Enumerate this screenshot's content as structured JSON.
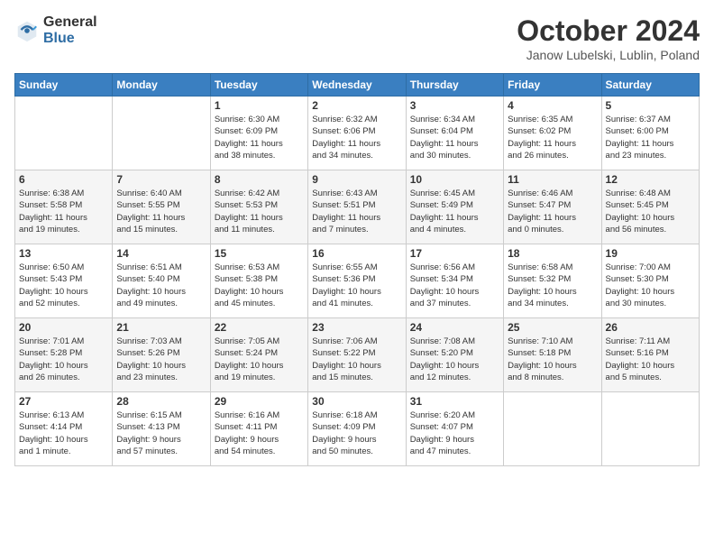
{
  "logo": {
    "general": "General",
    "blue": "Blue"
  },
  "title": "October 2024",
  "location": "Janow Lubelski, Lublin, Poland",
  "days_of_week": [
    "Sunday",
    "Monday",
    "Tuesday",
    "Wednesday",
    "Thursday",
    "Friday",
    "Saturday"
  ],
  "weeks": [
    [
      {
        "num": "",
        "info": ""
      },
      {
        "num": "",
        "info": ""
      },
      {
        "num": "1",
        "info": "Sunrise: 6:30 AM\nSunset: 6:09 PM\nDaylight: 11 hours\nand 38 minutes."
      },
      {
        "num": "2",
        "info": "Sunrise: 6:32 AM\nSunset: 6:06 PM\nDaylight: 11 hours\nand 34 minutes."
      },
      {
        "num": "3",
        "info": "Sunrise: 6:34 AM\nSunset: 6:04 PM\nDaylight: 11 hours\nand 30 minutes."
      },
      {
        "num": "4",
        "info": "Sunrise: 6:35 AM\nSunset: 6:02 PM\nDaylight: 11 hours\nand 26 minutes."
      },
      {
        "num": "5",
        "info": "Sunrise: 6:37 AM\nSunset: 6:00 PM\nDaylight: 11 hours\nand 23 minutes."
      }
    ],
    [
      {
        "num": "6",
        "info": "Sunrise: 6:38 AM\nSunset: 5:58 PM\nDaylight: 11 hours\nand 19 minutes."
      },
      {
        "num": "7",
        "info": "Sunrise: 6:40 AM\nSunset: 5:55 PM\nDaylight: 11 hours\nand 15 minutes."
      },
      {
        "num": "8",
        "info": "Sunrise: 6:42 AM\nSunset: 5:53 PM\nDaylight: 11 hours\nand 11 minutes."
      },
      {
        "num": "9",
        "info": "Sunrise: 6:43 AM\nSunset: 5:51 PM\nDaylight: 11 hours\nand 7 minutes."
      },
      {
        "num": "10",
        "info": "Sunrise: 6:45 AM\nSunset: 5:49 PM\nDaylight: 11 hours\nand 4 minutes."
      },
      {
        "num": "11",
        "info": "Sunrise: 6:46 AM\nSunset: 5:47 PM\nDaylight: 11 hours\nand 0 minutes."
      },
      {
        "num": "12",
        "info": "Sunrise: 6:48 AM\nSunset: 5:45 PM\nDaylight: 10 hours\nand 56 minutes."
      }
    ],
    [
      {
        "num": "13",
        "info": "Sunrise: 6:50 AM\nSunset: 5:43 PM\nDaylight: 10 hours\nand 52 minutes."
      },
      {
        "num": "14",
        "info": "Sunrise: 6:51 AM\nSunset: 5:40 PM\nDaylight: 10 hours\nand 49 minutes."
      },
      {
        "num": "15",
        "info": "Sunrise: 6:53 AM\nSunset: 5:38 PM\nDaylight: 10 hours\nand 45 minutes."
      },
      {
        "num": "16",
        "info": "Sunrise: 6:55 AM\nSunset: 5:36 PM\nDaylight: 10 hours\nand 41 minutes."
      },
      {
        "num": "17",
        "info": "Sunrise: 6:56 AM\nSunset: 5:34 PM\nDaylight: 10 hours\nand 37 minutes."
      },
      {
        "num": "18",
        "info": "Sunrise: 6:58 AM\nSunset: 5:32 PM\nDaylight: 10 hours\nand 34 minutes."
      },
      {
        "num": "19",
        "info": "Sunrise: 7:00 AM\nSunset: 5:30 PM\nDaylight: 10 hours\nand 30 minutes."
      }
    ],
    [
      {
        "num": "20",
        "info": "Sunrise: 7:01 AM\nSunset: 5:28 PM\nDaylight: 10 hours\nand 26 minutes."
      },
      {
        "num": "21",
        "info": "Sunrise: 7:03 AM\nSunset: 5:26 PM\nDaylight: 10 hours\nand 23 minutes."
      },
      {
        "num": "22",
        "info": "Sunrise: 7:05 AM\nSunset: 5:24 PM\nDaylight: 10 hours\nand 19 minutes."
      },
      {
        "num": "23",
        "info": "Sunrise: 7:06 AM\nSunset: 5:22 PM\nDaylight: 10 hours\nand 15 minutes."
      },
      {
        "num": "24",
        "info": "Sunrise: 7:08 AM\nSunset: 5:20 PM\nDaylight: 10 hours\nand 12 minutes."
      },
      {
        "num": "25",
        "info": "Sunrise: 7:10 AM\nSunset: 5:18 PM\nDaylight: 10 hours\nand 8 minutes."
      },
      {
        "num": "26",
        "info": "Sunrise: 7:11 AM\nSunset: 5:16 PM\nDaylight: 10 hours\nand 5 minutes."
      }
    ],
    [
      {
        "num": "27",
        "info": "Sunrise: 6:13 AM\nSunset: 4:14 PM\nDaylight: 10 hours\nand 1 minute."
      },
      {
        "num": "28",
        "info": "Sunrise: 6:15 AM\nSunset: 4:13 PM\nDaylight: 9 hours\nand 57 minutes."
      },
      {
        "num": "29",
        "info": "Sunrise: 6:16 AM\nSunset: 4:11 PM\nDaylight: 9 hours\nand 54 minutes."
      },
      {
        "num": "30",
        "info": "Sunrise: 6:18 AM\nSunset: 4:09 PM\nDaylight: 9 hours\nand 50 minutes."
      },
      {
        "num": "31",
        "info": "Sunrise: 6:20 AM\nSunset: 4:07 PM\nDaylight: 9 hours\nand 47 minutes."
      },
      {
        "num": "",
        "info": ""
      },
      {
        "num": "",
        "info": ""
      }
    ]
  ]
}
